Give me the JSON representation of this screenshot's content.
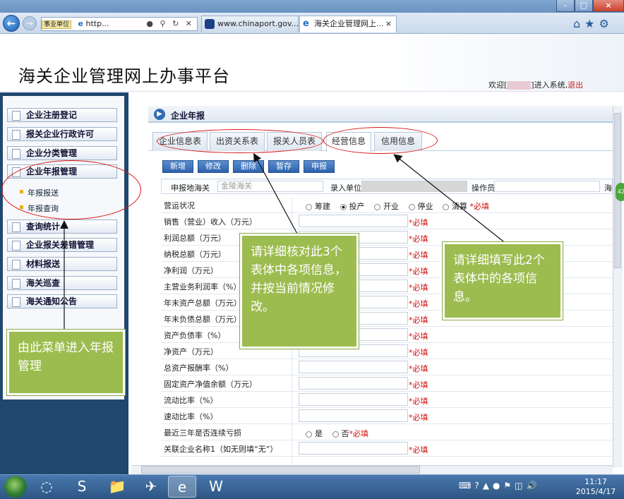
{
  "browser": {
    "address_prefix": "事业单位",
    "address_text": "http...",
    "tabs": [
      {
        "label": "www.chinaport.gov...."
      },
      {
        "label": "海关企业管理网上...",
        "close": "×"
      }
    ],
    "window_buttons": {
      "min": "–",
      "max": "□",
      "close": "×"
    }
  },
  "header": {
    "title": "海关企业管理网上办事平台",
    "welcome_prefix": "欢迎[",
    "welcome_suffix": "]进入系统,",
    "logout": "退出"
  },
  "sidebar": {
    "items": [
      {
        "label": "企业注册登记"
      },
      {
        "label": "报关企业行政许可"
      },
      {
        "label": "企业分类管理"
      },
      {
        "label": "企业年报管理"
      },
      {
        "label": "查询统计"
      },
      {
        "label": "企业报关差错管理"
      },
      {
        "label": "材料报送"
      },
      {
        "label": "海关巡查"
      },
      {
        "label": "海关通知公告"
      }
    ],
    "subitems": [
      {
        "label": "年报报送"
      },
      {
        "label": "年报查询"
      }
    ]
  },
  "main": {
    "section_title": "企业年报",
    "tabs": [
      {
        "label": "企业信息表"
      },
      {
        "label": "出资关系表"
      },
      {
        "label": "报关人员表"
      },
      {
        "label": "经营信息"
      },
      {
        "label": "信用信息"
      }
    ],
    "buttons": {
      "add": "新增",
      "edit": "修改",
      "delete": "删除",
      "save": "暂存",
      "submit": "申报"
    },
    "top_fields": {
      "customs_label": "申报地海关",
      "customs_value": "金陵海关",
      "unit_label": "录入单位",
      "operator_label": "操作员",
      "trailing": "海"
    },
    "rows": [
      {
        "label": "营运状况",
        "options": [
          "筹建",
          "投产",
          "开业",
          "停业",
          "清算"
        ],
        "selected": "投产",
        "required": "*必填"
      },
      {
        "label": "销售（营业）收入（万元）",
        "required": "*必填"
      },
      {
        "label": "利润总额（万元）",
        "required": "*必填"
      },
      {
        "label": "纳税总额（万元）",
        "required": "*必填"
      },
      {
        "label": "净利润（万元）",
        "required": "*必填"
      },
      {
        "label": "主营业务利润率（%）",
        "required": "*必填"
      },
      {
        "label": "年末资产总额（万元）",
        "required": "*必填"
      },
      {
        "label": "年末负债总额（万元）",
        "required": "*必填"
      },
      {
        "label": "资产负债率（%）",
        "required": "*必填"
      },
      {
        "label": "净资产（万元）",
        "required": "*必填"
      },
      {
        "label": "总资产报酬率（%）",
        "required": "*必填"
      },
      {
        "label": "固定资产净值余额（万元）",
        "required": "*必填"
      },
      {
        "label": "流动比率（%）",
        "required": "*必填"
      },
      {
        "label": "速动比率（%）",
        "required": "*必填"
      },
      {
        "label": "最近三年是否连续亏损",
        "options": [
          "是",
          "否"
        ],
        "selected": "",
        "required": "*必填"
      },
      {
        "label": "关联企业名称1（如无则填“无”）",
        "required": "*必填"
      }
    ]
  },
  "callouts": {
    "menu_note": "由此菜单进入年报管理",
    "verify_note": "请详细核对此3个表体中各项信息，并按当前情况修改。",
    "fill_note": "请详细填写此2个表体中的各项信息。"
  },
  "taskbar": {
    "time": "11:17",
    "date": "2015/4/17"
  },
  "side_badge": "42"
}
